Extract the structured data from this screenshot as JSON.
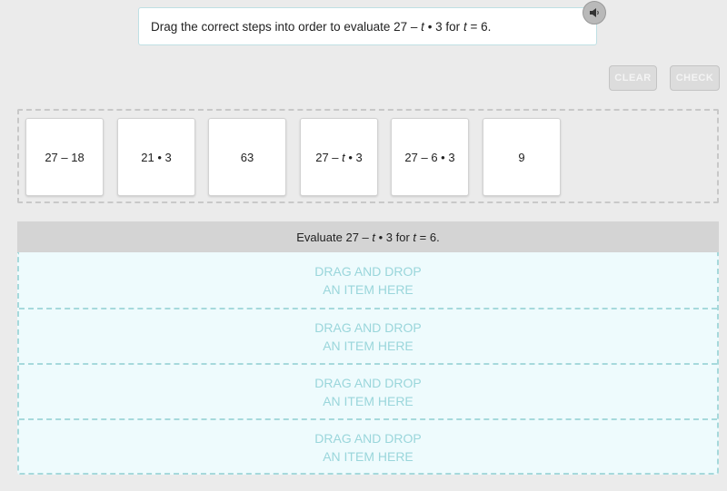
{
  "prompt": {
    "text_before": "Drag the correct steps into order to evaluate 27 – ",
    "var1": "t",
    "text_middle": " • 3 for ",
    "var2": "t",
    "text_after": " = 6."
  },
  "audio_icon": "speaker-icon",
  "buttons": {
    "clear": "CLEAR",
    "check": "CHECK"
  },
  "tiles": [
    {
      "pre": "27 – 18",
      "var": "",
      "post": ""
    },
    {
      "pre": "21 • 3",
      "var": "",
      "post": ""
    },
    {
      "pre": "63",
      "var": "",
      "post": ""
    },
    {
      "pre": "27 – ",
      "var": "t",
      "post": " • 3"
    },
    {
      "pre": "27 – 6 • 3",
      "var": "",
      "post": ""
    },
    {
      "pre": "9",
      "var": "",
      "post": ""
    }
  ],
  "answer_header": {
    "text_before": "Evaluate 27 – ",
    "var1": "t",
    "text_middle": " • 3 for ",
    "var2": "t",
    "text_after": " = 6."
  },
  "drop_slots": [
    {
      "line1": "DRAG AND DROP",
      "line2": "AN ITEM HERE"
    },
    {
      "line1": "DRAG AND DROP",
      "line2": "AN ITEM HERE"
    },
    {
      "line1": "DRAG AND DROP",
      "line2": "AN ITEM HERE"
    },
    {
      "line1": "DRAG AND DROP",
      "line2": "AN ITEM HERE"
    }
  ]
}
